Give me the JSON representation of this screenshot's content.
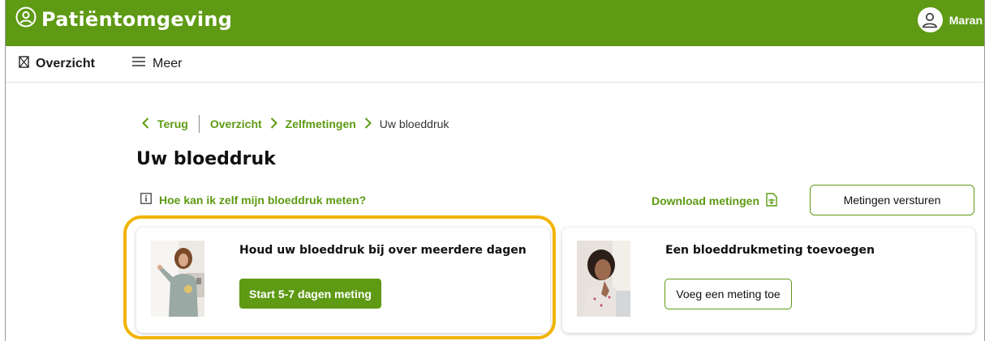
{
  "app": {
    "title": "Patiëntomgeving",
    "user_name": "Maran"
  },
  "nav": {
    "overzicht": "Overzicht",
    "meer": "Meer"
  },
  "breadcrumb": {
    "back": "Terug",
    "items": [
      "Overzicht",
      "Zelfmetingen"
    ],
    "current": "Uw bloeddruk"
  },
  "page": {
    "title": "Uw bloeddruk",
    "info_link": "Hoe kan ik zelf mijn bloeddruk meten?",
    "download_link": "Download metingen",
    "send_button": "Metingen versturen"
  },
  "cards": [
    {
      "title": "Houd uw bloeddruk bij over meerdere dagen",
      "button": "Start 5-7 dagen meting"
    },
    {
      "title": "Een bloeddrukmeting toevoegen",
      "button": "Voeg een meting toe"
    }
  ],
  "colors": {
    "brand_green": "#5e9a14",
    "highlight": "#f1b400"
  },
  "icons": {
    "brand": "user-circle-icon",
    "user": "user-icon",
    "overzicht": "hourglass-icon",
    "meer": "hamburger-icon",
    "info": "info-icon",
    "download": "pdf-download-icon"
  }
}
